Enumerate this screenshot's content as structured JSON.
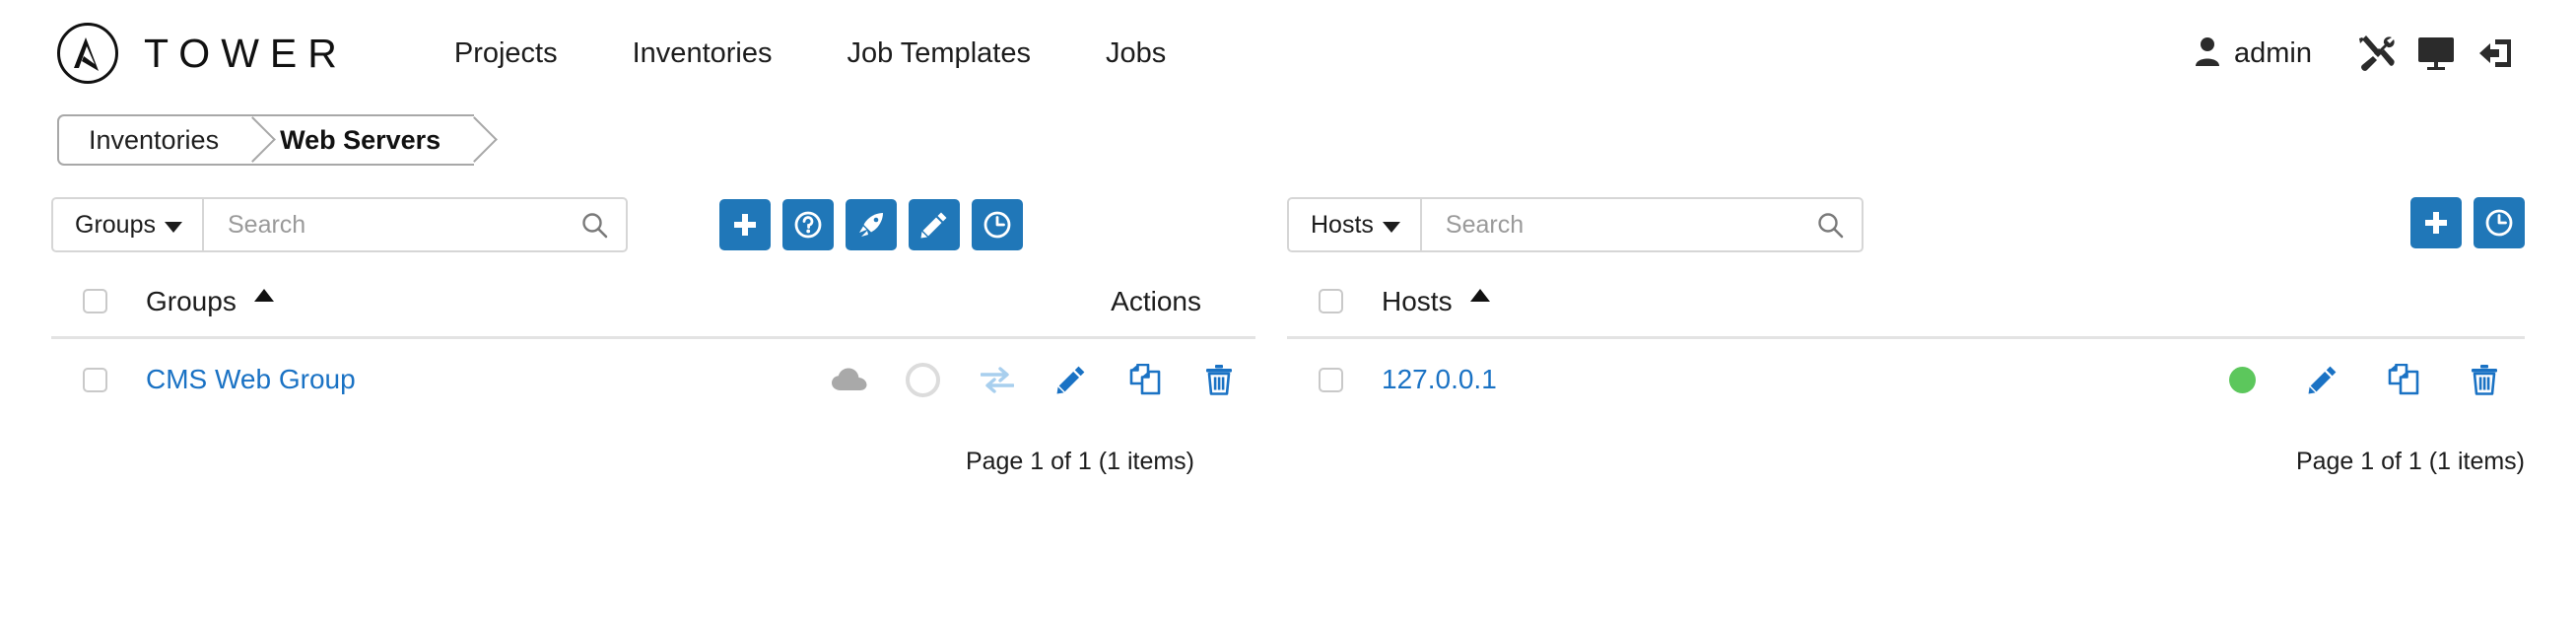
{
  "app": {
    "brand_name": "TOWER",
    "brand_icon": "ansible-logo-icon"
  },
  "topnav": {
    "items": [
      {
        "label": "Projects",
        "name": "nav-projects"
      },
      {
        "label": "Inventories",
        "name": "nav-inventories"
      },
      {
        "label": "Job Templates",
        "name": "nav-job-templates"
      },
      {
        "label": "Jobs",
        "name": "nav-jobs"
      }
    ],
    "user": {
      "name": "admin",
      "icon": "user-icon"
    },
    "icons": [
      {
        "name": "settings-tools-icon",
        "title": "Settings"
      },
      {
        "name": "monitor-icon",
        "title": "Dashboard"
      },
      {
        "name": "logout-icon",
        "title": "Log out"
      }
    ]
  },
  "breadcrumb": {
    "items": [
      {
        "label": "Inventories",
        "active": false
      },
      {
        "label": "Web Servers",
        "active": true
      }
    ]
  },
  "groups_panel": {
    "search": {
      "filter_label": "Groups",
      "placeholder": "Search",
      "value": "",
      "search_icon": "search-icon"
    },
    "toolbar_buttons": [
      {
        "name": "add-group-button",
        "icon": "plus-icon",
        "title": "Add group"
      },
      {
        "name": "help-button",
        "icon": "question-mark-icon",
        "title": "Help"
      },
      {
        "name": "launch-button",
        "icon": "rocket-icon",
        "title": "Run commands"
      },
      {
        "name": "edit-inventory-button",
        "icon": "pencil-icon",
        "title": "Edit inventory"
      },
      {
        "name": "activity-stream-button",
        "icon": "clock-icon",
        "title": "Activity stream"
      }
    ],
    "table": {
      "select_all_checkbox": false,
      "columns": [
        {
          "label": "Groups",
          "sort": "asc"
        },
        {
          "label": "Actions",
          "sort": null
        }
      ],
      "rows": [
        {
          "selected": false,
          "name": "CMS Web Group",
          "actions": [
            {
              "name": "cloud-sync-icon",
              "state": "disabled"
            },
            {
              "name": "status-ring-icon",
              "state": "idle"
            },
            {
              "name": "sync-arrows-icon",
              "state": "muted"
            },
            {
              "name": "pencil-icon",
              "state": "active"
            },
            {
              "name": "copy-icon",
              "state": "active"
            },
            {
              "name": "trash-icon",
              "state": "active"
            }
          ]
        }
      ]
    },
    "pagination": "Page 1 of 1 (1 items)"
  },
  "hosts_panel": {
    "search": {
      "filter_label": "Hosts",
      "placeholder": "Search",
      "value": "",
      "search_icon": "search-icon"
    },
    "toolbar_buttons": [
      {
        "name": "add-host-button",
        "icon": "plus-icon",
        "title": "Add host"
      },
      {
        "name": "activity-stream-button",
        "icon": "clock-icon",
        "title": "Activity stream"
      }
    ],
    "table": {
      "select_all_checkbox": false,
      "columns": [
        {
          "label": "Hosts",
          "sort": "asc"
        }
      ],
      "rows": [
        {
          "selected": false,
          "name": "127.0.0.1",
          "actions": [
            {
              "name": "status-dot-icon",
              "state": "enabled"
            },
            {
              "name": "pencil-icon",
              "state": "active"
            },
            {
              "name": "copy-icon",
              "state": "active"
            },
            {
              "name": "trash-icon",
              "state": "active"
            }
          ]
        }
      ]
    },
    "pagination": "Page 1 of 1 (1 items)"
  },
  "colors": {
    "accent_blue": "#2077b8",
    "link_blue": "#1a72c4",
    "status_green": "#5cc75c",
    "muted_gray": "#a9a9a9",
    "light_blue": "#a8cfee"
  }
}
